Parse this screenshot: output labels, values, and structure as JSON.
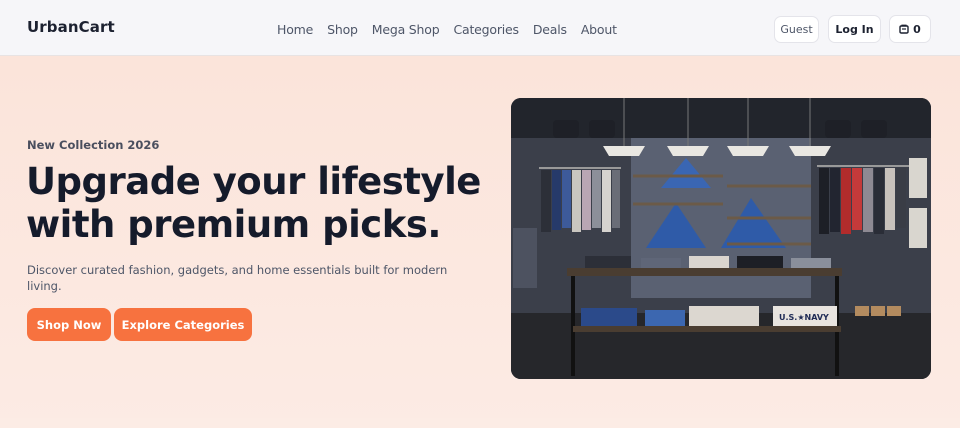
{
  "brand": {
    "name": "UrbanCart"
  },
  "nav": {
    "links": [
      "Home",
      "Shop",
      "Mega Shop",
      "Categories",
      "Deals",
      "About"
    ]
  },
  "account": {
    "guest_label": "Guest",
    "login_label": "Log In",
    "cart_count": "0",
    "cart_icon": "cart-icon"
  },
  "hero": {
    "eyebrow": "New Collection 2026",
    "headline": "Upgrade your lifestyle with premium picks.",
    "subtext": "Discover curated fashion, gadgets, and home essentials built for modern living.",
    "cta_primary": "Shop Now",
    "cta_secondary": "Explore Categories"
  },
  "colors": {
    "accent": "#f7723f",
    "navbar_bg": "#f6f6f9",
    "hero_bg": "#fbe4da",
    "text_dark": "#151b2b",
    "text_muted": "#4e5668"
  }
}
